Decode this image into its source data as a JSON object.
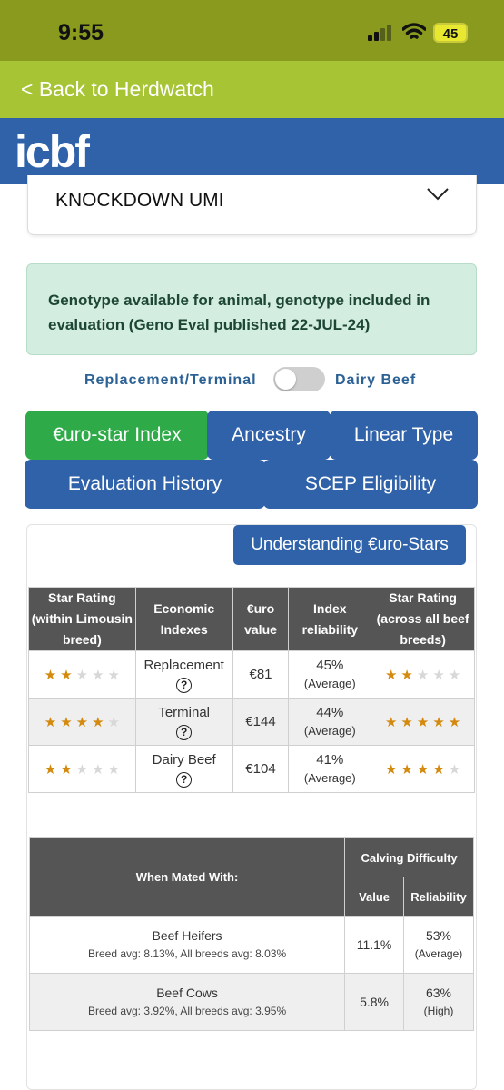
{
  "status_bar": {
    "time": "9:55",
    "battery": "45"
  },
  "nav": {
    "back_label": "< Back to Herdwatch"
  },
  "brand": {
    "logo_text": "icbf"
  },
  "animal_select": {
    "selected": "KNOCKDOWN UMI"
  },
  "genotype_alert": {
    "text": "Genotype available for animal, genotype included in evaluation (Geno Eval published 22-JUL-24)"
  },
  "toggle": {
    "left_label": "Replacement/Terminal",
    "right_label": "Dairy Beef"
  },
  "tabs": [
    {
      "label": "€uro-star Index",
      "active": true
    },
    {
      "label": "Ancestry",
      "active": false
    },
    {
      "label": "Linear Type",
      "active": false
    },
    {
      "label": "Evaluation History",
      "active": false
    },
    {
      "label": "SCEP Eligibility",
      "active": false
    }
  ],
  "understanding_button": "Understanding €uro-Stars",
  "index_table": {
    "headers": [
      "Star Rating (within Limousin breed)",
      "Economic Indexes",
      "€uro value",
      "Index reliability",
      "Star Rating (across all beef breeds)"
    ],
    "rows": [
      {
        "stars_within": 2,
        "index": "Replacement",
        "value": "€81",
        "reliability": "45%",
        "reliability_level": "(Average)",
        "stars_across": 2
      },
      {
        "stars_within": 4,
        "index": "Terminal",
        "value": "€144",
        "reliability": "44%",
        "reliability_level": "(Average)",
        "stars_across": 5
      },
      {
        "stars_within": 2,
        "index": "Dairy Beef",
        "value": "€104",
        "reliability": "41%",
        "reliability_level": "(Average)",
        "stars_across": 4
      }
    ],
    "help_symbol": "?"
  },
  "calving_table": {
    "header_mated": "When Mated With:",
    "header_group": "Calving Difficulty",
    "header_value": "Value",
    "header_reliability": "Reliability",
    "rows": [
      {
        "name": "Beef Heifers",
        "sub": "Breed avg: 8.13%, All breeds avg: 8.03%",
        "value": "11.1%",
        "reliability": "53%",
        "reliability_level": "(Average)"
      },
      {
        "name": "Beef Cows",
        "sub": "Breed avg: 3.92%, All breeds avg: 3.95%",
        "value": "5.8%",
        "reliability": "63%",
        "reliability_level": "(High)"
      }
    ]
  },
  "colors": {
    "status_bar": "#8a9a1e",
    "back_bar": "#a6c434",
    "brand_blue": "#2f62a8",
    "active_tab": "#2eaa48",
    "star_on": "#d48a0e",
    "star_off": "#d8d8d8",
    "table_header": "#555555"
  }
}
